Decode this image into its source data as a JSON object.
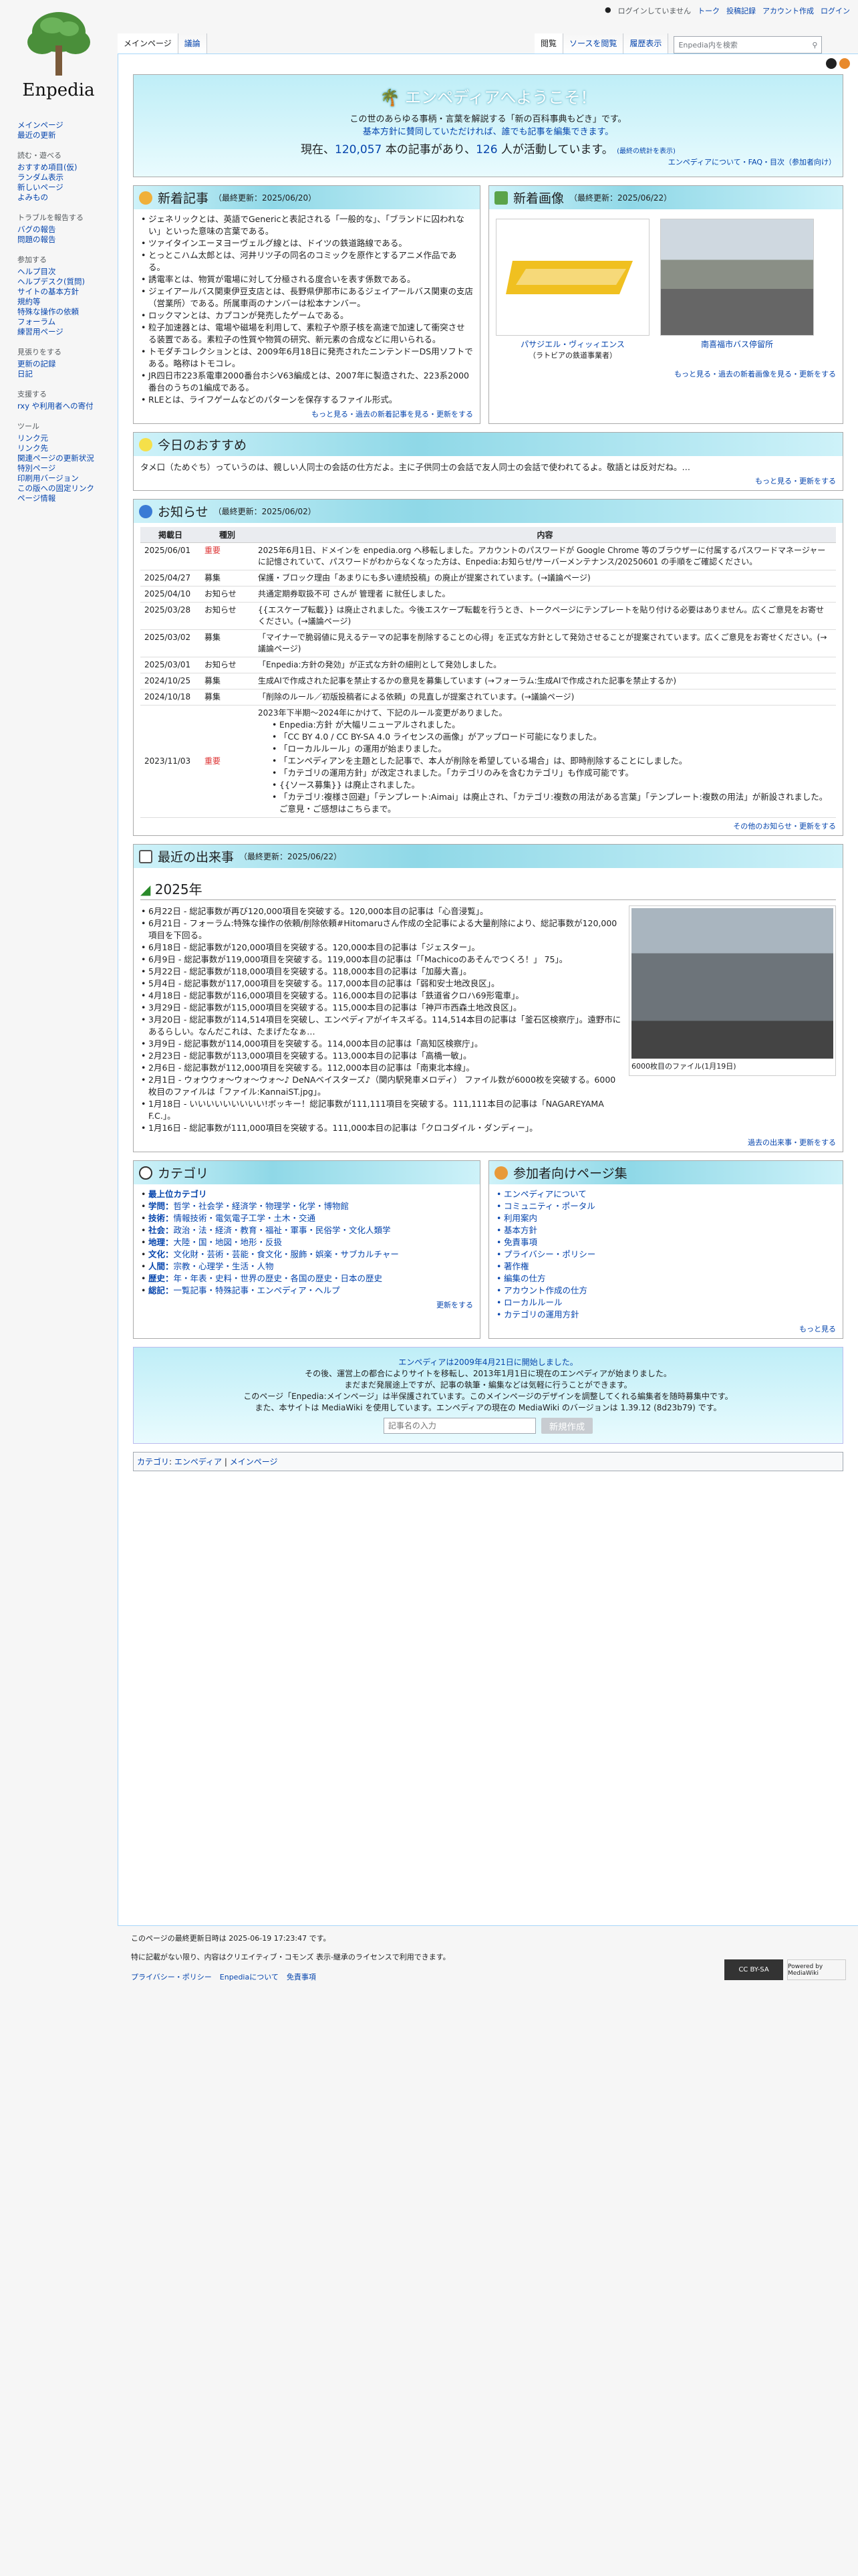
{
  "logo": {
    "wordmark": "Enpedia"
  },
  "personal": [
    "ログインしていません",
    "トーク",
    "投稿記録",
    "アカウント作成",
    "ログイン"
  ],
  "tabs_left": [
    "メインページ",
    "議論"
  ],
  "tabs_right": [
    "閲覧",
    "ソースを閲覧",
    "履歴表示"
  ],
  "search": {
    "placeholder": "Enpedia内を検索"
  },
  "sidebar": [
    {
      "title": "",
      "items": [
        "メインページ",
        "最近の更新"
      ]
    },
    {
      "title": "読む・遊べる",
      "items": [
        "おすすめ項目(仮)",
        "ランダム表示",
        "新しいページ",
        "よみもの"
      ]
    },
    {
      "title": "トラブルを報告する",
      "items": [
        "バグの報告",
        "問題の報告"
      ]
    },
    {
      "title": "参加する",
      "items": [
        "ヘルプ目次",
        "ヘルプデスク(質問)",
        "サイトの基本方針",
        "規約等",
        "特殊な操作の依頼",
        "フォーラム",
        "練習用ページ"
      ]
    },
    {
      "title": "見張りをする",
      "items": [
        "更新の記録",
        "日記"
      ]
    },
    {
      "title": "支援する",
      "items": [
        "rxy や利用者への寄付"
      ]
    },
    {
      "title": "ツール",
      "items": [
        "リンク元",
        "リンク先",
        "関連ページの更新状況",
        "特別ページ",
        "印刷用バージョン",
        "この版への固定リンク",
        "ページ情報"
      ]
    }
  ],
  "welcome": {
    "title": "エンペディアへようこそ！",
    "line1": "この世のあらゆる事柄・言葉を解説する「新の百科事典もどき」です。",
    "line2": "基本方針に賛同していただければ、誰でも記事を編集できます。",
    "count_pre": "現在、",
    "articles": "120,057",
    "mid": " 本の記事があり、",
    "users": "126",
    "end": " 人が活動しています。",
    "note": "(最終の統計を表示)",
    "links": "エンペディアについて・FAQ・目次（参加者向け）"
  },
  "new_articles": {
    "title": "新着記事",
    "updated": "（最終更新：2025/06/20）",
    "items": [
      "ジェネリックとは、英語でGenericと表記される「一般的な」、「ブランドに囚われない」といった意味の言葉である。",
      "ツァイタインエーヌヨーヴェルグ線とは、ドイツの鉄道路線である。",
      "とっとこハム太郎とは、河井リツ子の同名のコミックを原作とするアニメ作品である。",
      "誘電率とは、物質が電場に対して分極される度合いを表す係数である。",
      "ジェイアールバス関東伊豆支店とは、長野県伊那市にあるジェイアールバス関東の支店（営業所）である。所属車両のナンバーは松本ナンバー。",
      "ロックマンとは、カプコンが発売したゲームである。",
      "粒子加速器とは、電場や磁場を利用して、素粒子や原子核を高速で加速して衝突させる装置である。素粒子の性質や物質の研究、新元素の合成などに用いられる。",
      "トモダチコレクションとは、2009年6月18日に発売されたニンテンドーDS用ソフトである。略称はトモコレ。",
      "JR四日市223系電車2000番台ホシV63編成とは、2007年に製造された、223系2000番台のうちの1編成である。",
      "RLEとは、ライフゲームなどのパターンを保存するファイル形式。"
    ],
    "more": "もっと見る・過去の新着記事を見る・更新をする"
  },
  "new_images": {
    "title": "新着画像",
    "updated": "（最終更新：2025/06/22）",
    "items": [
      {
        "caption": "パサジエル・ヴィッィエンス",
        "sub": "（ラトビアの鉄道事業者）"
      },
      {
        "caption": "南喜福市バス停留所",
        "sub": ""
      }
    ],
    "more": "もっと見る・過去の新着画像を見る・更新をする"
  },
  "recommend": {
    "title": "今日のおすすめ",
    "text": "タメ口（ためぐち）っていうのは、親しい人同士の会話の仕方だよ。主に子供同士の会話で友人同士の会話で使われてるよ。敬語とは反対だね。…",
    "more": "もっと見る・更新をする"
  },
  "news": {
    "title": "お知らせ",
    "updated": "（最終更新：2025/06/02）",
    "headers": [
      "掲載日",
      "種別",
      "内容"
    ],
    "rows": [
      {
        "date": "2025/06/01",
        "type": "重要",
        "red": true,
        "text": "2025年6月1日、ドメインを enpedia.org へ移転しました。アカウントのパスワードが Google Chrome 等のブラウザーに付属するパスワードマネージャーに記憶されていて、パスワードがわからなくなった方は、Enpedia:お知らせ/サーバーメンテナンス/20250601 の手順をご確認ください。"
      },
      {
        "date": "2025/04/27",
        "type": "募集",
        "red": false,
        "text": "保護・ブロック理由「あまりにも多い連続投稿」の廃止が提案されています。(→議論ページ)"
      },
      {
        "date": "2025/04/10",
        "type": "お知らせ",
        "red": false,
        "text": "共通定期券取扱不可 さんが 管理者 に就任しました。"
      },
      {
        "date": "2025/03/28",
        "type": "お知らせ",
        "red": false,
        "text": "{{エスケープ転載}} は廃止されました。今後エスケープ転載を行うとき、トークページにテンプレートを貼り付ける必要はありません。広くご意見をお寄せください。(→議論ページ)"
      },
      {
        "date": "2025/03/02",
        "type": "募集",
        "red": false,
        "text": "「マイナーで脆弱値に見えるテーマの記事を削除することの心得」を正式な方針として発効させることが提案されています。広くご意見をお寄せください。(→議論ページ)"
      },
      {
        "date": "2025/03/01",
        "type": "お知らせ",
        "red": false,
        "text": "「Enpedia:方針の発効」が正式な方針の細則として発効しました。"
      },
      {
        "date": "2024/10/25",
        "type": "募集",
        "red": false,
        "text": "生成AIで作成された記事を禁止するかの意見を募集しています (→フォーラム:生成AIで作成された記事を禁止するか)"
      },
      {
        "date": "2024/10/18",
        "type": "募集",
        "red": false,
        "text": "「削除のルール／初版投稿者による依頼」の見直しが提案されています。(→議論ページ)"
      }
    ],
    "big": {
      "date": "2023/11/03",
      "type": "重要",
      "intro": "2023年下半期〜2024年にかけて、下記のルール変更がありました。",
      "items": [
        "Enpedia:方針 が大幅リニューアルされました。",
        "「CC BY 4.0 / CC BY-SA 4.0 ライセンスの画像」がアップロード可能になりました。",
        "「ローカルルール」の運用が始まりました。",
        "「エンペディアンを主題とした記事で、本人が削除を希望している場合」は、即時削除することにしました。",
        "「カテゴリの運用方針」が改定されました。「カテゴリのみを含むカテゴリ」も作成可能です。",
        "{{ソース募集}} は廃止されました。",
        "「カテゴリ:複様さ回避」「テンプレート:Aimai」は廃止され、「カテゴリ:複数の用法がある言葉」「テンプレート:複数の用法」が新設されました。ご意見・ご感想はこちらまで。"
      ]
    },
    "more": "その他のお知らせ・更新をする"
  },
  "events": {
    "title": "最近の出来事",
    "updated": "（最終更新：2025/06/22）",
    "year": "2025年",
    "items": [
      "6月22日 - 総記事数が再び120,000項目を突破する。120,000本目の記事は「心音浸覧」。",
      "6月21日 - フォーラム:特殊な操作の依頼/削除依頼#Hitomaruさん作成の全記事による大量削除により、総記事数が120,000項目を下回る。",
      "6月18日 - 総記事数が120,000項目を突破する。120,000本目の記事は「ジェスター」。",
      "6月9日 - 総記事数が119,000項目を突破する。119,000本目の記事は「「Machicoのあそんでつくろ！」 75」。",
      "5月22日 - 総記事数が118,000項目を突破する。118,000本目の記事は「加藤大喜」。",
      "5月4日 - 総記事数が117,000項目を突破する。117,000本目の記事は「弱和安士地改良区」。",
      "4月18日 - 総記事数が116,000項目を突破する。116,000本目の記事は「鉄道省クロハ69形電車」。",
      "3月29日 - 総記事数が115,000項目を突破する。115,000本目の記事は「神戸市西森土地改良区」。",
      "3月20日 - 総記事数が114,514項目を突破し、エンペディアがイキスギる。114,514本目の記事は「釜石区検察庁」。遠野市にあるらしい。なんだこれは、たまげたなぁ…",
      "3月9日 - 総記事数が114,000項目を突破する。114,000本目の記事は「高知区検察庁」。",
      "2月23日 - 総記事数が113,000項目を突破する。113,000本目の記事は「高橋一敏」。",
      "2月6日 - 総記事数が112,000項目を突破する。112,000本目の記事は「南東北本線」。",
      "2月1日 - ウォウウォ～ウォ～ウォ～♪ DeNAベイスターズ♪（関内駅発車メロディ） ファイル数が6000枚を突破する。6000枚目のファイルは「ファイル:KannaiST.jpg」。",
      "1月18日 - いいいいいいいいい!ボッキー！総記事数が111,111項目を突破する。111,111本目の記事は「NAGAREYAMA F.C.」。",
      "1月16日 - 総記事数が111,000項目を突破する。111,000本目の記事は「クロコダイル・ダンディー」。"
    ],
    "image_caption": "6000枚目のファイル(1月19日)",
    "more": "過去の出来事・更新をする"
  },
  "categories": {
    "title": "カテゴリ",
    "items": [
      [
        "最上位カテゴリ",
        ""
      ],
      [
        "学問：",
        "哲学・社会学・経済学・物理学・化学・博物館"
      ],
      [
        "技術：",
        "情報技術・電気電子工学・土木・交通"
      ],
      [
        "社会：",
        "政治・法・経済・教育・福祉・軍事・民俗学・文化人類学"
      ],
      [
        "地理：",
        "大陸・国・地図・地形・反扱"
      ],
      [
        "文化：",
        "文化財・芸術・芸能・食文化・服飾・娯楽・サブカルチャー"
      ],
      [
        "人間：",
        "宗教・心理学・生活・人物"
      ],
      [
        "歴史：",
        "年・年表・史料・世界の歴史・各国の歴史・日本の歴史"
      ],
      [
        "総記：",
        "一覧記事・特殊記事・エンペディア・ヘルプ"
      ]
    ],
    "more": "更新をする"
  },
  "participants": {
    "title": "参加者向けページ集",
    "items": [
      "エンペディアについて",
      "コミュニティ・ポータル",
      "利用案内",
      "基本方針",
      "免責事項",
      "プライバシー・ポリシー",
      "著作権",
      "編集の仕方",
      "アカウント作成の仕方",
      "ローカルルール",
      "カテゴリの運用方針"
    ],
    "more": "もっと見る"
  },
  "about": {
    "l1": "エンペディアは2009年4月21日に開始しました。",
    "l2": "その後、運営上の都合によりサイトを移転し、2013年1月1日に現在のエンペディアが始まりました。",
    "l3": "まだまだ発展途上ですが、記事の執筆・編集などは気軽に行うことができます。",
    "l4": "このページ「Enpedia:メインページ」は半保護されています。このメインページのデザインを調整してくれる編集者を随時募集中です。",
    "l5": "また、本サイトは MediaWiki を使用しています。エンペディアの現在の MediaWiki のバージョンは 1.39.12 (8d23b79) です。",
    "input_placeholder": "記事名の入力",
    "button": "新規作成"
  },
  "catlinks": [
    "カテゴリ",
    "エンペディア",
    "メインページ"
  ],
  "footer": {
    "l1": "このページの最終更新日時は 2025-06-19 17:23:47 です。",
    "l2": "特に記載がない限り、内容はクリエイティブ・コモンズ 表示-継承のライセンスで利用できます。",
    "links": [
      "プライバシー・ポリシー",
      "Enpediaについて",
      "免責事項"
    ],
    "cc": "CC BY-SA",
    "mw": "Powered by MediaWiki"
  },
  "colors": {
    "link": "#0645ad",
    "header": "#8fd8e7",
    "red": "#d33"
  }
}
